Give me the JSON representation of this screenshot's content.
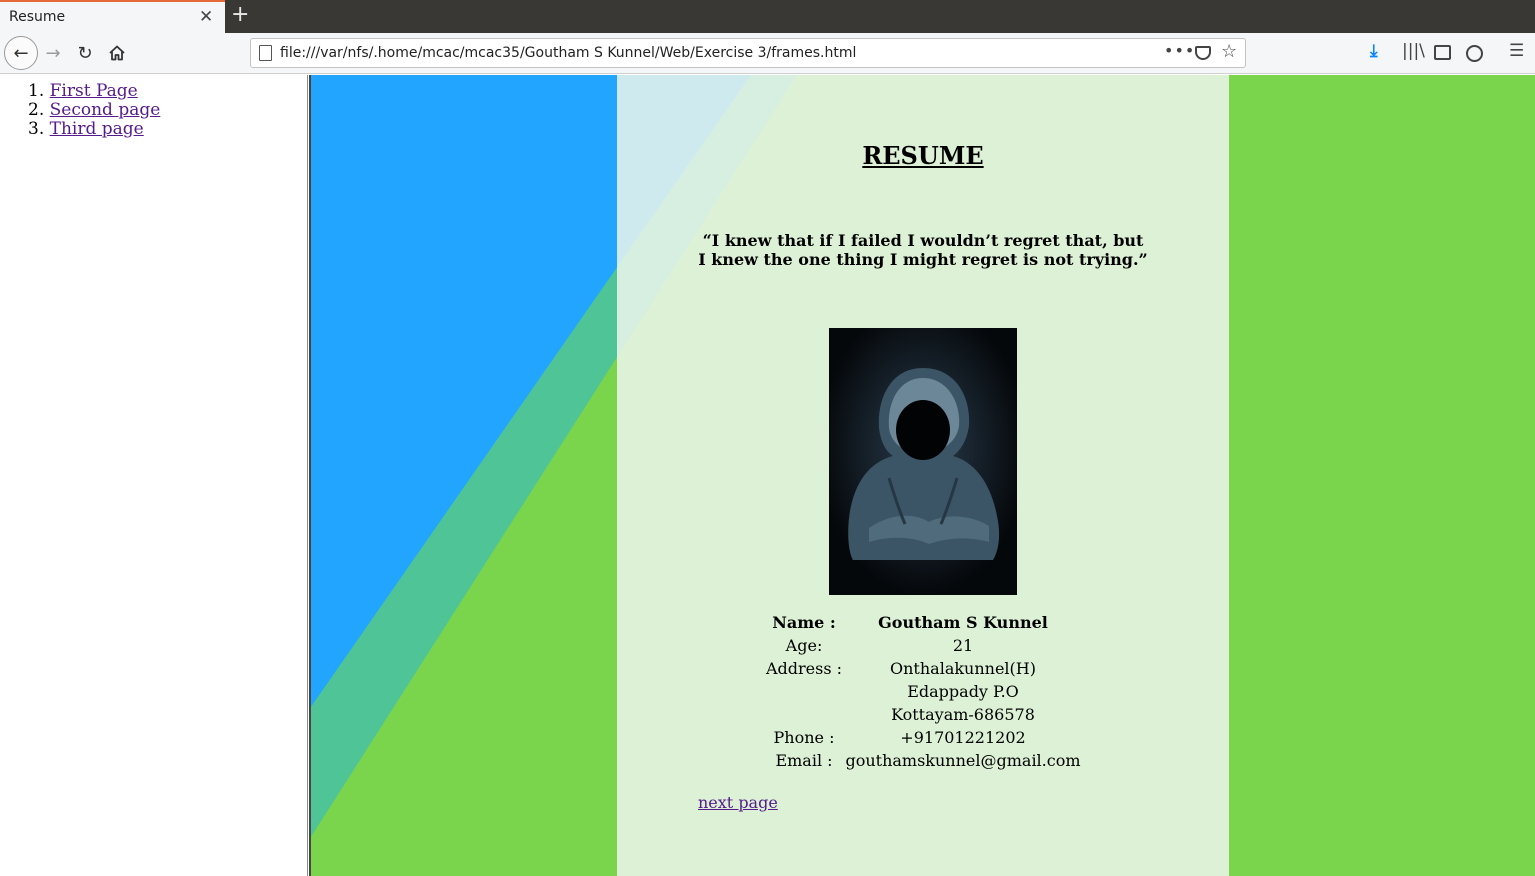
{
  "browser": {
    "tab_title": "Resume",
    "tab_close_glyph": "✕",
    "new_tab_glyph": "+",
    "back_glyph": "←",
    "forward_glyph": "→",
    "reload_glyph": "↻",
    "home_glyph": "⌂",
    "url": "file:///var/nfs/.home/mcac/mcac35/Goutham S Kunnel/Web/Exercise 3/frames.html",
    "page_actions_glyph": "•••",
    "bookmark_glyph": "☆",
    "download_glyph": "⤓",
    "library_glyph": "|||\\",
    "menu_glyph": "☰",
    "accent_color": "#e66a37"
  },
  "nav_frame": {
    "items": [
      {
        "number": "1.",
        "label": "First Page"
      },
      {
        "number": "2.",
        "label": "Second page"
      },
      {
        "number": "3.",
        "label": "Third page"
      }
    ]
  },
  "resume": {
    "title": "RESUME",
    "quote_line1": "“I knew that if I failed I wouldn’t regret that, but",
    "quote_line2": "I knew the one thing I might regret is not trying.”",
    "photo_subject": "hooded-figure-icon",
    "name_label": "Name :",
    "name_value": "Goutham S Kunnel",
    "age_label": "Age:",
    "age_value": "21",
    "address_label": "Address :",
    "address_line1": "Onthalakunnel(H)",
    "address_line2": "Edappady P.O",
    "address_line3": "Kottayam-686578",
    "phone_label": "Phone :",
    "phone_value": "+91701221202",
    "email_label": "Email :",
    "email_value": "gouthamskunnel@gmail.com",
    "next_link": "next page"
  },
  "colors": {
    "background_green": "#7ad54c",
    "background_blue": "#21a5ff",
    "link_visited": "#551a8b"
  }
}
